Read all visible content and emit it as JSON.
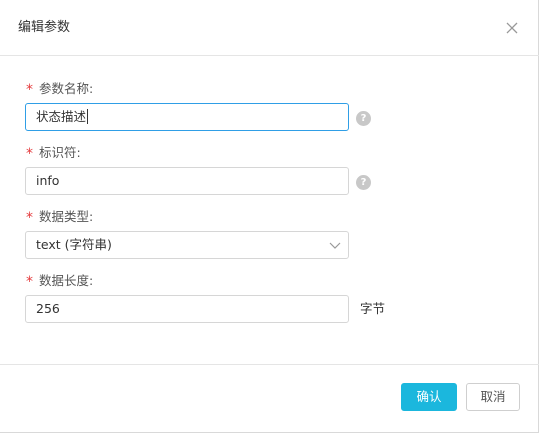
{
  "dialog": {
    "title": "编辑参数",
    "close_icon": "close-icon"
  },
  "form": {
    "name": {
      "required_mark": "*",
      "label": "参数名称:",
      "value": "状态描述",
      "help_icon": "?"
    },
    "identifier": {
      "required_mark": "*",
      "label": "标识符:",
      "value": "info",
      "help_icon": "?"
    },
    "data_type": {
      "required_mark": "*",
      "label": "数据类型:",
      "selected": "text (字符串)"
    },
    "data_length": {
      "required_mark": "*",
      "label": "数据长度:",
      "value": "256",
      "unit": "字节"
    }
  },
  "footer": {
    "confirm_label": "确认",
    "cancel_label": "取消"
  },
  "colors": {
    "primary": "#1bb7dd",
    "required": "#e4393c",
    "focus_border": "#2f9ee6"
  }
}
